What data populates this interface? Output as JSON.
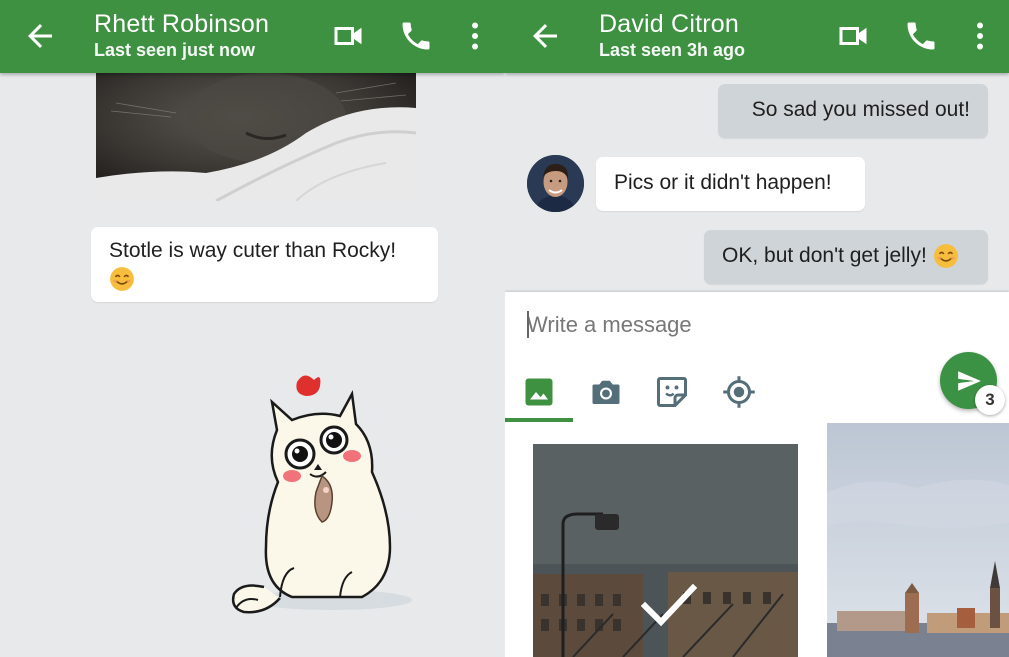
{
  "left_chat": {
    "contact_name": "Rhett Robinson",
    "status": "Last seen just now",
    "messages": [
      {
        "text": "Stotle is way cuter than Rocky!",
        "direction": "incoming"
      }
    ],
    "icons": [
      "back-arrow-icon",
      "video-call-icon",
      "phone-icon",
      "more-vert-icon"
    ]
  },
  "right_chat": {
    "contact_name": "David Citron",
    "status": "Last seen 3h ago",
    "messages": [
      {
        "text": "So sad you missed out!",
        "direction": "outgoing"
      },
      {
        "text": "Pics or it didn't happen!",
        "direction": "incoming"
      },
      {
        "text": "OK, but don't get jelly!",
        "direction": "outgoing"
      }
    ],
    "compose": {
      "placeholder": "Write a message",
      "selected_count": "3",
      "tools": [
        "gallery-icon",
        "camera-icon",
        "sticker-icon",
        "location-icon"
      ],
      "active_tool": "gallery-icon"
    }
  },
  "colors": {
    "header_green": "#3f9142",
    "chat_background": "#e7e9eb",
    "outgoing_bubble": "#cfd4d8",
    "incoming_bubble": "#ffffff"
  }
}
